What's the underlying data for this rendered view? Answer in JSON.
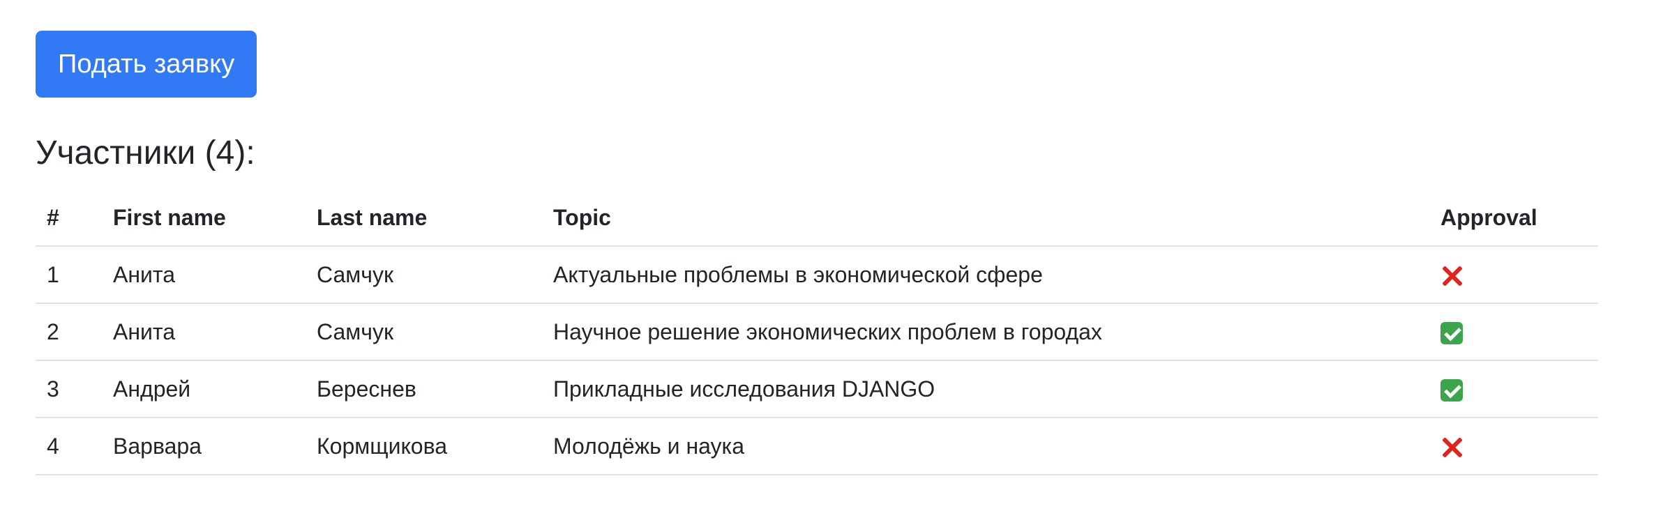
{
  "submit_button": {
    "label": "Подать заявку"
  },
  "participants": {
    "title": "Участники (4):",
    "columns": {
      "num": "#",
      "first_name": "First name",
      "last_name": "Last name",
      "topic": "Topic",
      "approval": "Approval"
    },
    "rows": [
      {
        "num": "1",
        "first_name": "Анита",
        "last_name": "Самчук",
        "topic": "Актуальные проблемы в экономической сфере",
        "approval": "cross-mark-icon"
      },
      {
        "num": "2",
        "first_name": "Анита",
        "last_name": "Самчук",
        "topic": "Научное решение экономических проблем в городах",
        "approval": "check-mark-icon"
      },
      {
        "num": "3",
        "first_name": "Андрей",
        "last_name": "Береснев",
        "topic": "Прикладные исследования DJANGO",
        "approval": "check-mark-icon"
      },
      {
        "num": "4",
        "first_name": "Варвара",
        "last_name": "Кормщикова",
        "topic": "Молодёжь и наука",
        "approval": "cross-mark-icon"
      }
    ]
  },
  "colors": {
    "button": "#3279f6",
    "approved": "#3aa54a",
    "rejected": "#e0231c",
    "text": "#212529",
    "divider": "#dee2e6"
  }
}
